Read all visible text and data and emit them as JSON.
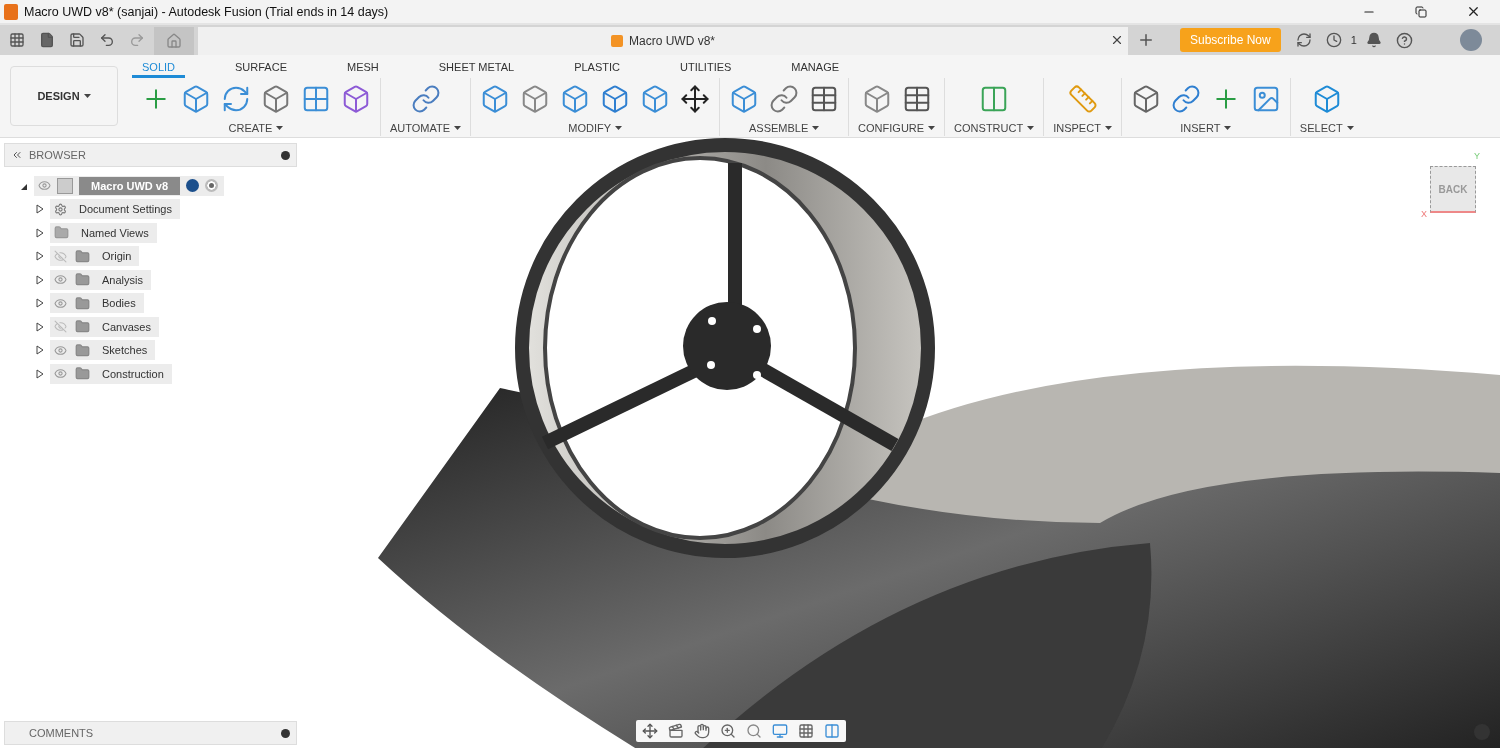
{
  "title_bar": {
    "title": "Macro UWD v8* (sanjai) - Autodesk Fusion (Trial ends in 14 days)"
  },
  "tab_bar": {
    "document_tab": "Macro UWD v8*",
    "subscribe": "Subscribe Now",
    "job_count": "1"
  },
  "toolbar": {
    "workspace": "DESIGN",
    "tabs": [
      {
        "label": "SOLID",
        "selected": true
      },
      {
        "label": "SURFACE",
        "selected": false
      },
      {
        "label": "MESH",
        "selected": false
      },
      {
        "label": "SHEET METAL",
        "selected": false
      },
      {
        "label": "PLASTIC",
        "selected": false
      },
      {
        "label": "UTILITIES",
        "selected": false
      },
      {
        "label": "MANAGE",
        "selected": false
      }
    ],
    "groups": [
      {
        "label": "CREATE"
      },
      {
        "label": "AUTOMATE"
      },
      {
        "label": "MODIFY"
      },
      {
        "label": "ASSEMBLE"
      },
      {
        "label": "CONFIGURE"
      },
      {
        "label": "CONSTRUCT"
      },
      {
        "label": "INSPECT"
      },
      {
        "label": "INSERT"
      },
      {
        "label": "SELECT"
      }
    ]
  },
  "browser": {
    "title": "BROWSER",
    "root": {
      "label": "Macro UWD v8",
      "expanded": true
    },
    "items": [
      {
        "label": "Document Settings",
        "kind": "settings"
      },
      {
        "label": "Named Views",
        "kind": "views"
      },
      {
        "label": "Origin",
        "kind": "folder",
        "visible": false
      },
      {
        "label": "Analysis",
        "kind": "folder",
        "visible": true
      },
      {
        "label": "Bodies",
        "kind": "folder",
        "visible": true
      },
      {
        "label": "Canvases",
        "kind": "folder",
        "visible": false
      },
      {
        "label": "Sketches",
        "kind": "folder",
        "visible": true
      },
      {
        "label": "Construction",
        "kind": "folder",
        "visible": true
      }
    ]
  },
  "viewcube": {
    "face": "BACK",
    "x_axis": "X",
    "y_axis": "Y"
  },
  "comments": {
    "title": "COMMENTS"
  }
}
